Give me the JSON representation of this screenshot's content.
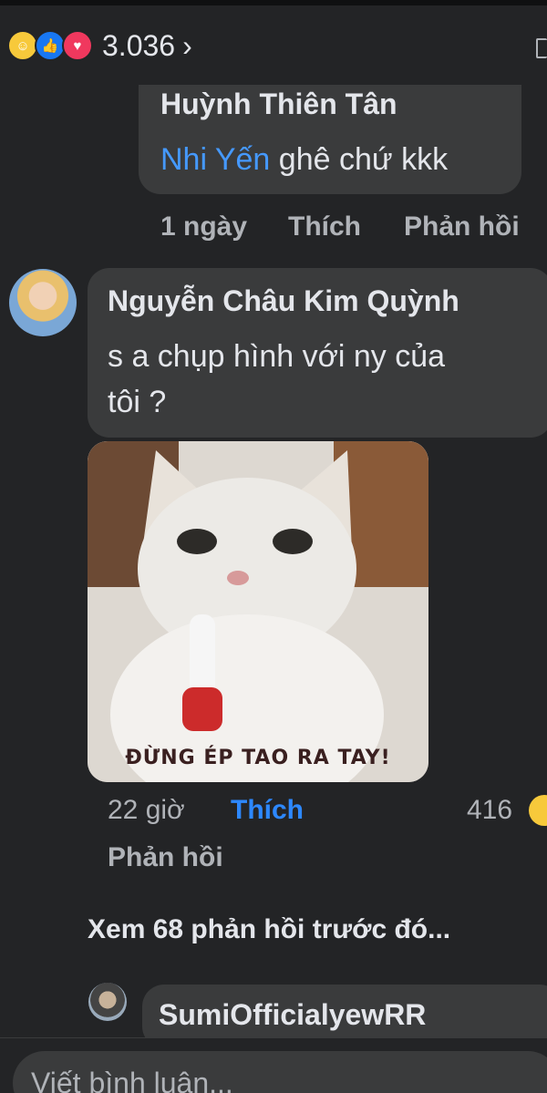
{
  "post": {
    "reaction_count": "3.036",
    "reactions": [
      "haha-icon",
      "like-icon",
      "love-icon"
    ]
  },
  "comments": [
    {
      "author": "Huỳnh Thiên Tân",
      "mention": "Nhi Yến",
      "text": " ghê chứ kkk",
      "time": "1 ngày",
      "like_label": "Thích",
      "reply_label": "Phản hồi"
    },
    {
      "author": "Nguyễn Châu Kim Quỳnh",
      "text_line1": "s a chụp hình với ny của",
      "text_line2": "tôi ?",
      "sticker_caption": "ĐỪNG ÉP TAO RA TAY!",
      "time": "22 giờ",
      "like_label": "Thích",
      "reply_label": "Phản hồi",
      "reaction_count": "416"
    }
  ],
  "view_previous_replies": "Xem 68 phản hồi trước đó...",
  "reply_preview": {
    "author": "SumiOfficialyewRR"
  },
  "composer": {
    "placeholder": "Viết bình luận..."
  },
  "colors": {
    "background": "#232426",
    "bubble": "#3a3b3c",
    "accent": "#2d88ff"
  }
}
